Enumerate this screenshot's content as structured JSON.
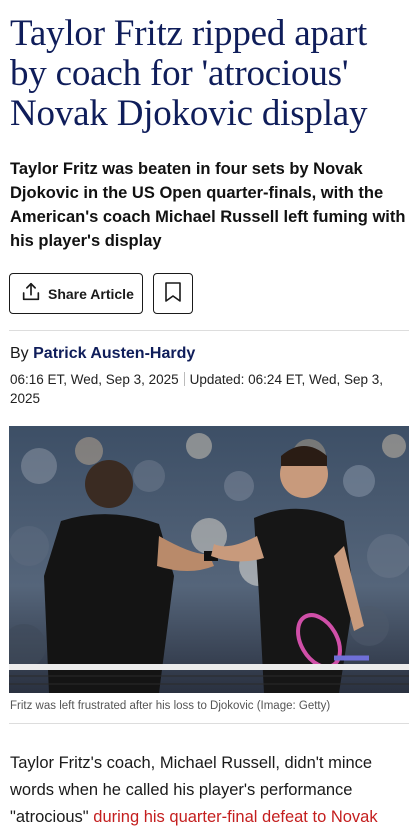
{
  "article": {
    "headline": "Taylor Fritz ripped apart by coach for 'atrocious' Novak Djokovic display",
    "standfirst": "Taylor Fritz was beaten in four sets by Novak Djokovic in the US Open quarter-finals, with the American's coach Michael Russell left fuming with his player's display",
    "share_label": "Share Article",
    "byline_prefix": "By",
    "author": "Patrick Austen-Hardy",
    "published": "06:16 ET, Wed, Sep 3, 2025",
    "updated": "Updated: 06:24 ET, Wed, Sep 3, 2025",
    "image_caption": "Fritz was left frustrated after his loss to Djokovic (Image: Getty)",
    "body_intro": "Taylor Fritz's coach, Michael Russell, didn't mince words when he called his player's performance \"atrocious\"",
    "body_link": "during his quarter-final defeat to Novak"
  },
  "icons": {
    "share": "share-upload-icon",
    "bookmark": "bookmark-icon"
  },
  "colors": {
    "headline": "#0f1d5a",
    "author": "#0f1d5a",
    "link": "#c41e1e",
    "caption": "#555555",
    "rule": "#dddddd"
  }
}
